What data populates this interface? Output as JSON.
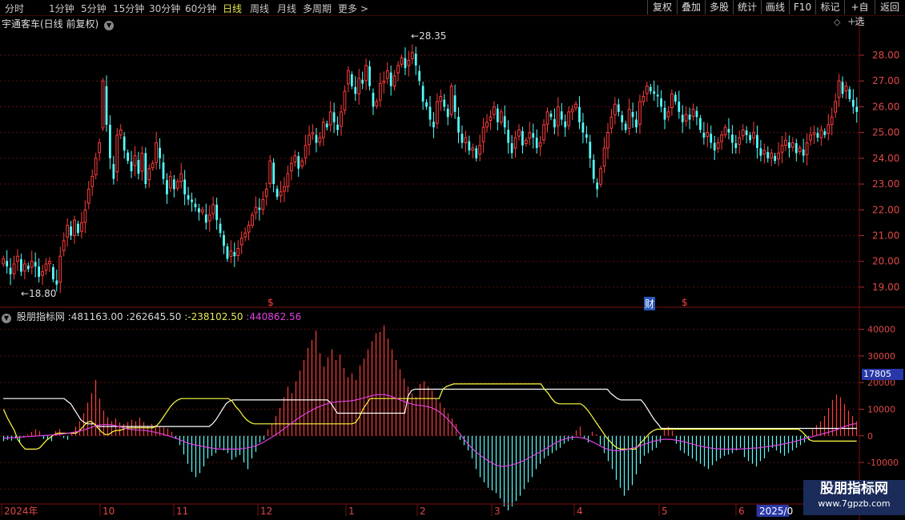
{
  "toolbar": {
    "periods": [
      "分时",
      "1分钟",
      "5分钟",
      "15分钟",
      "30分钟",
      "60分钟",
      "日线",
      "周线",
      "月线",
      "多周期",
      "更多 >"
    ],
    "active_period": "日线",
    "right_buttons": [
      "复权",
      "叠加",
      "多股",
      "统计",
      "画线",
      "F10",
      "标记",
      "+自选",
      "返回"
    ]
  },
  "price_panel": {
    "title": "宇通客车(日线 前复权)",
    "high_marker": "28.35",
    "low_marker": "18.80",
    "event_markers": [
      "$",
      "财",
      "$"
    ]
  },
  "indicator_panel": {
    "name": "股朋指标网",
    "values": [
      {
        "text": "481163.00",
        "color": "#d8d8d8"
      },
      {
        "text": "262645.50",
        "color": "#d8d8d8"
      },
      {
        "text": "-238102.50",
        "color": "#e8e85a"
      },
      {
        "text": "440862.56",
        "color": "#e040e0"
      }
    ],
    "current_value": "17805"
  },
  "watermark": {
    "title": "股朋指标网",
    "url": "www.7gpzb.com"
  },
  "chart_data": {
    "type": "candlestick",
    "price_axis": {
      "ticks": [
        "28.00",
        "27.00",
        "26.00",
        "25.00",
        "24.00",
        "23.00",
        "22.00",
        "21.00",
        "20.00",
        "19.00"
      ],
      "range": [
        18.5,
        28.9
      ]
    },
    "indicator_axis": {
      "ticks": [
        "40000",
        "30000",
        "20000",
        "10000",
        "0",
        "-10000",
        "-20000"
      ],
      "range": [
        -25000,
        45000
      ]
    },
    "date_labels": [
      "2024年",
      "10",
      "11",
      "12",
      "1",
      "2",
      "3",
      "4",
      "5",
      "6",
      "2025/0"
    ],
    "colors": {
      "up": "#ff3c3c",
      "down": "#54ffff",
      "white_line": "#ffffff",
      "yellow_line": "#ffff40",
      "magenta_line": "#e040e0"
    },
    "closes": [
      20.1,
      19.8,
      19.5,
      19.9,
      20.2,
      19.6,
      19.9,
      19.7,
      20.0,
      19.8,
      19.4,
      19.6,
      19.9,
      20.0,
      19.3,
      19.1,
      20.2,
      20.8,
      21.4,
      21.0,
      21.6,
      21.1,
      21.5,
      22.0,
      22.8,
      23.3,
      24.0,
      24.6,
      27.0,
      25.3,
      24.0,
      23.2,
      24.9,
      25.1,
      24.3,
      23.9,
      23.5,
      24.1,
      23.4,
      24.2,
      23.0,
      23.6,
      23.8,
      24.6,
      24.0,
      23.2,
      22.6,
      23.3,
      22.8,
      23.1,
      23.4,
      22.6,
      22.4,
      22.3,
      22.1,
      21.9,
      22.0,
      21.5,
      21.8,
      22.2,
      21.6,
      21.1,
      20.6,
      20.1,
      20.4,
      20.2,
      20.5,
      20.9,
      21.1,
      21.4,
      21.8,
      22.1,
      22.0,
      22.4,
      22.8,
      23.9,
      23.0,
      22.5,
      22.7,
      22.9,
      23.4,
      23.8,
      24.1,
      23.6,
      23.9,
      24.5,
      24.9,
      25.0,
      24.6,
      24.8,
      25.4,
      25.2,
      25.8,
      25.4,
      25.1,
      25.8,
      26.6,
      27.4,
      26.8,
      26.5,
      27.1,
      26.9,
      27.6,
      26.8,
      26.0,
      26.2,
      26.9,
      27.0,
      27.4,
      26.8,
      27.2,
      27.6,
      27.9,
      27.5,
      27.8,
      28.1,
      27.6,
      27.0,
      26.2,
      26.0,
      25.5,
      25.2,
      26.2,
      26.4,
      26.0,
      25.6,
      26.8,
      25.8,
      25.0,
      24.6,
      24.8,
      24.3,
      24.4,
      24.0,
      24.5,
      25.2,
      25.4,
      25.6,
      26.0,
      25.4,
      25.8,
      25.2,
      24.6,
      24.2,
      24.8,
      25.1,
      24.5,
      24.7,
      25.0,
      24.8,
      24.4,
      24.6,
      25.3,
      25.8,
      25.6,
      25.2,
      26.0,
      25.5,
      25.2,
      25.8,
      25.9,
      26.1,
      25.4,
      25.0,
      24.8,
      24.0,
      23.2,
      22.8,
      23.6,
      24.4,
      25.0,
      25.6,
      26.1,
      25.8,
      25.4,
      25.1,
      25.9,
      25.6,
      25.2,
      26.2,
      26.4,
      26.8,
      26.6,
      26.5,
      26.4,
      26.0,
      25.5,
      25.8,
      26.5,
      26.2,
      25.8,
      25.4,
      25.7,
      25.5,
      25.9,
      25.6,
      25.1,
      24.8,
      25.0,
      24.6,
      24.3,
      24.6,
      24.9,
      25.2,
      25.0,
      24.6,
      24.4,
      24.8,
      25.1,
      24.9,
      24.7,
      25.0,
      24.4,
      24.1,
      24.3,
      24.0,
      24.2,
      23.9,
      24.2,
      24.5,
      24.7,
      24.4,
      24.6,
      24.2,
      24.4,
      24.1,
      24.6,
      24.9,
      25.0,
      24.8,
      25.1,
      24.9,
      25.3,
      25.6,
      26.2,
      27.0,
      26.5,
      26.8,
      26.3,
      26.0,
      25.8
    ],
    "hist": [
      -2000,
      -1500,
      -1800,
      -1000,
      -2500,
      -500,
      500,
      1500,
      2500,
      1800,
      -1200,
      -1500,
      -2000,
      1800,
      2500,
      -800,
      -1500,
      1500,
      3500,
      5500,
      8500,
      12500,
      16000,
      21000,
      14000,
      9500,
      7000,
      5500,
      6500,
      5000,
      4500,
      5200,
      6000,
      5500,
      6800,
      5200,
      3800,
      4500,
      4000,
      3500,
      3200,
      2800,
      1500,
      -1200,
      -3500,
      -7000,
      -10500,
      -13500,
      -15500,
      -14000,
      -11500,
      -8500,
      -7500,
      -6500,
      -4500,
      -5500,
      -6500,
      -9000,
      -8000,
      -7200,
      -10000,
      -12500,
      -8500,
      -6000,
      -2500,
      -1500,
      2500,
      4500,
      7500,
      10500,
      14500,
      18500,
      16000,
      20500,
      24500,
      28500,
      33000,
      36000,
      39500,
      31000,
      26000,
      29500,
      32500,
      28500,
      30500,
      25500,
      22000,
      23500,
      21000,
      26500,
      29000,
      32500,
      35500,
      38500,
      39000,
      41500,
      36500,
      32500,
      28500,
      25000,
      21500,
      18500,
      16000,
      14500,
      19500,
      20500,
      18500,
      17000,
      14000,
      12500,
      10500,
      8500,
      6500,
      4500,
      -1500,
      -3500,
      -5500,
      -8500,
      -12500,
      -15500,
      -17500,
      -19500,
      -20500,
      -21500,
      -23500,
      -26500,
      -28000,
      -26500,
      -24500,
      -22500,
      -20000,
      -17500,
      -15500,
      -12500,
      -10500,
      -8500,
      -7500,
      -6500,
      -5500,
      -4500,
      -3000,
      -2000,
      -1500,
      2000,
      3500,
      -1000,
      -2500,
      1500,
      500,
      -3500,
      -6500,
      -9500,
      -12500,
      -16500,
      -19500,
      -22500,
      -20500,
      -18500,
      -14500,
      -10500,
      -7500,
      -6500,
      -5500,
      -4500,
      -2500,
      2500,
      3500,
      2000,
      -3000,
      -5500,
      -6500,
      -7500,
      -8500,
      -9500,
      -10500,
      -11500,
      -12500,
      -11000,
      -9500,
      -8500,
      -7500,
      -7000,
      -6500,
      -5500,
      -4500,
      -8000,
      -9500,
      -10500,
      -11500,
      -9500,
      -8500,
      -6000,
      -4500,
      -5500,
      -6500,
      -7500,
      -6500,
      -5500,
      -4500,
      -3500,
      -2500,
      -1500,
      2500,
      4000,
      5500,
      7500,
      10500,
      13500,
      15500,
      14500,
      12000,
      9500,
      7500,
      5500
    ],
    "white_line": [
      14000,
      14000,
      14000,
      14000,
      14000,
      14000,
      14000,
      14000,
      14000,
      14000,
      14000,
      14000,
      14000,
      14000,
      14000,
      14000,
      14000,
      14000,
      14000,
      13000,
      12000,
      10000,
      8000,
      6000,
      5000,
      4500,
      4500,
      4500,
      3500,
      3500,
      3500,
      3500,
      3500,
      3500,
      3500,
      3500,
      3500,
      3500,
      3500,
      3500,
      3500,
      3500,
      3500,
      3500,
      3500,
      3500,
      3500,
      3500,
      3500,
      3500,
      3500,
      3500,
      3500,
      3500,
      3500,
      3500,
      3500,
      3500,
      3500,
      3500,
      3500,
      3500,
      4500,
      6000,
      8000,
      10000,
      12000,
      13000,
      13500,
      13500,
      13500,
      13500,
      13500,
      13500,
      13500,
      13500,
      13500,
      13500,
      13500,
      13500,
      13500,
      13500,
      13500,
      13500,
      13500,
      13500,
      13500,
      13500,
      13500,
      13500,
      13500,
      13500,
      13500,
      13500,
      13500,
      13500,
      13500,
      12500,
      10500,
      8500,
      8500,
      8500,
      8500,
      8500,
      8500,
      8500,
      8500,
      8500,
      8500,
      8500,
      8500,
      8500,
      8500,
      8500,
      8500,
      8500,
      8500,
      8500,
      8500,
      8500,
      15000,
      17000,
      17500,
      17500,
      17500,
      17500,
      17500,
      17500,
      17500,
      17500,
      17500,
      17500,
      17500,
      17500,
      17500,
      17500,
      17500,
      17500,
      17500,
      17500,
      17500,
      17500,
      17500,
      17500,
      17500,
      17500,
      17500,
      17500,
      17500,
      17500,
      17500,
      17500,
      17500,
      17500,
      17500,
      17500,
      17500,
      17500,
      17500,
      17500,
      17500,
      17500,
      17500,
      17500,
      17500,
      17500,
      17500,
      17500,
      17500,
      17500,
      17500,
      17500,
      17500,
      17500,
      17500,
      17500,
      17500,
      17500,
      17500,
      17500,
      16000,
      15000,
      14000,
      13500,
      13500,
      13500,
      13500,
      13500,
      13500,
      13500,
      12000,
      10000,
      8000,
      6000,
      4500,
      2800,
      2800,
      2800,
      2800,
      2800,
      2800,
      2800,
      2800,
      2800,
      2800,
      2800,
      2800,
      2800,
      2800,
      2800,
      2800,
      2800,
      2800,
      2800,
      2800,
      2800,
      2800,
      2800,
      2800,
      2800,
      2800,
      2800,
      2800,
      2800,
      2800,
      2800,
      2800,
      2800,
      2800,
      2800,
      2800,
      2800,
      2800,
      2800,
      2800,
      2800,
      2800,
      2800,
      2800,
      2800,
      2800,
      2800,
      2800,
      2800,
      2800,
      2800,
      2800,
      2800,
      2800,
      2800,
      2800,
      2800,
      2800,
      2800
    ],
    "yellow_line": [
      10000,
      7000,
      4500,
      2000,
      -1500,
      -3500,
      -5000,
      -5000,
      -5000,
      -5000,
      -4500,
      -3000,
      -1500,
      -500,
      500,
      1000,
      1000,
      1000,
      1000,
      1000,
      1000,
      2000,
      3500,
      5000,
      5500,
      4500,
      3000,
      1500,
      500,
      500,
      1500,
      2000,
      2000,
      2500,
      3000,
      3000,
      3000,
      3000,
      3000,
      3000,
      3000,
      3000,
      3500,
      5000,
      7000,
      9000,
      11000,
      12500,
      13500,
      14000,
      14000,
      14000,
      14000,
      14000,
      14000,
      14000,
      14000,
      14000,
      14000,
      14000,
      14000,
      14000,
      14000,
      13000,
      11000,
      9500,
      7500,
      6000,
      5000,
      4500,
      4500,
      4500,
      4500,
      4500,
      4500,
      4500,
      4500,
      4500,
      4500,
      4500,
      4500,
      4500,
      4500,
      4500,
      4500,
      4500,
      4500,
      4500,
      4500,
      4500,
      4500,
      4500,
      4500,
      4500,
      4500,
      4500,
      4500,
      5000,
      7000,
      10000,
      12000,
      14000,
      14000,
      14000,
      14000,
      14000,
      14000,
      14000,
      14000,
      14000,
      14000,
      14000,
      14000,
      14000,
      14000,
      14000,
      14000,
      14000,
      14000,
      14000,
      14000,
      17500,
      18500,
      19000,
      19500,
      19500,
      19500,
      19500,
      19500,
      19500,
      19500,
      19500,
      19500,
      19500,
      19500,
      19500,
      19500,
      19500,
      19500,
      19500,
      19500,
      19500,
      19500,
      19500,
      19500,
      19500,
      19500,
      19500,
      19500,
      17500,
      16000,
      14000,
      12500,
      12000,
      12000,
      12000,
      12000,
      12000,
      12000,
      12000,
      11000,
      9500,
      7500,
      5500,
      3500,
      1500,
      -500,
      -2000,
      -3500,
      -4500,
      -5000,
      -5000,
      -5000,
      -5000,
      -5000,
      -3500,
      -2000,
      -500,
      1000,
      2000,
      2500,
      2500,
      2500,
      2500,
      2500,
      2500,
      2500,
      2500,
      2500,
      2500,
      2500,
      2500,
      2500,
      2500,
      2500,
      2500,
      2500,
      2500,
      2500,
      2500,
      2500,
      2500,
      2500,
      2500,
      2500,
      2500,
      2500,
      2500,
      2500,
      2500,
      2500,
      2500,
      2500,
      2500,
      2500,
      2500,
      2500,
      2500,
      2500,
      2500,
      1500,
      0,
      -1500,
      -2000,
      -2000,
      -2000,
      -2000,
      -2000,
      -2000,
      -2000,
      -2000,
      -2000,
      -2000,
      -2000,
      -2000,
      -2000
    ],
    "magenta_line": [
      -1000,
      -800,
      -700,
      -600,
      -500,
      -400,
      -300,
      -200,
      -100,
      0,
      100,
      200,
      300,
      400,
      500,
      700,
      900,
      1100,
      1400,
      1700,
      2000,
      2500,
      3000,
      3500,
      4000,
      4200,
      4300,
      4200,
      4000,
      3600,
      3200,
      2800,
      2500,
      2300,
      2200,
      2100,
      2000,
      1800,
      1500,
      1200,
      800,
      400,
      0,
      -500,
      -1000,
      -1600,
      -2200,
      -2800,
      -3200,
      -3500,
      -3800,
      -4100,
      -4400,
      -4600,
      -4800,
      -5000,
      -5000,
      -5000,
      -5000,
      -5000,
      -4900,
      -4800,
      -4500,
      -4200,
      -3800,
      -3200,
      -2500,
      -1600,
      -700,
      200,
      1200,
      2300,
      3400,
      4500,
      5600,
      6600,
      7600,
      8500,
      9300,
      10100,
      10800,
      11400,
      11900,
      12300,
      12600,
      12800,
      12900,
      13000,
      13100,
      13300,
      13600,
      14000,
      14400,
      14800,
      15200,
      15400,
      15500,
      15400,
      15100,
      14600,
      14000,
      13400,
      12800,
      12300,
      11900,
      11600,
      11400,
      11200,
      10900,
      10500,
      9800,
      8800,
      7600,
      6200,
      4600,
      2800,
      900,
      -1000,
      -2800,
      -4400,
      -5800,
      -7000,
      -8100,
      -9100,
      -10000,
      -10800,
      -11300,
      -11500,
      -11300,
      -11000,
      -10600,
      -10100,
      -9500,
      -8800,
      -8000,
      -7200,
      -6400,
      -5600,
      -4800,
      -3900,
      -3000,
      -2200,
      -1600,
      -1100,
      -700,
      -500,
      -500,
      -700,
      -1100,
      -1700,
      -2400,
      -3200,
      -4000,
      -4700,
      -5200,
      -5500,
      -5600,
      -5500,
      -5300,
      -5000,
      -4600,
      -4200,
      -3700,
      -3200,
      -2700,
      -2200,
      -1800,
      -1500,
      -1300,
      -1300,
      -1400,
      -1600,
      -1900,
      -2200,
      -2600,
      -3000,
      -3400,
      -3800,
      -4100,
      -4400,
      -4600,
      -4800,
      -4900,
      -5000,
      -5000,
      -5000,
      -5000,
      -5000,
      -4900,
      -4800,
      -4700,
      -4600,
      -4500,
      -4300,
      -4100,
      -3900,
      -3700,
      -3500,
      -3200,
      -2900,
      -2600,
      -2200,
      -1800,
      -1400,
      -1000,
      -600,
      -200,
      200,
      600,
      1000,
      1400,
      1800,
      2300,
      2900,
      3500,
      4000,
      4400,
      4600
    ]
  }
}
